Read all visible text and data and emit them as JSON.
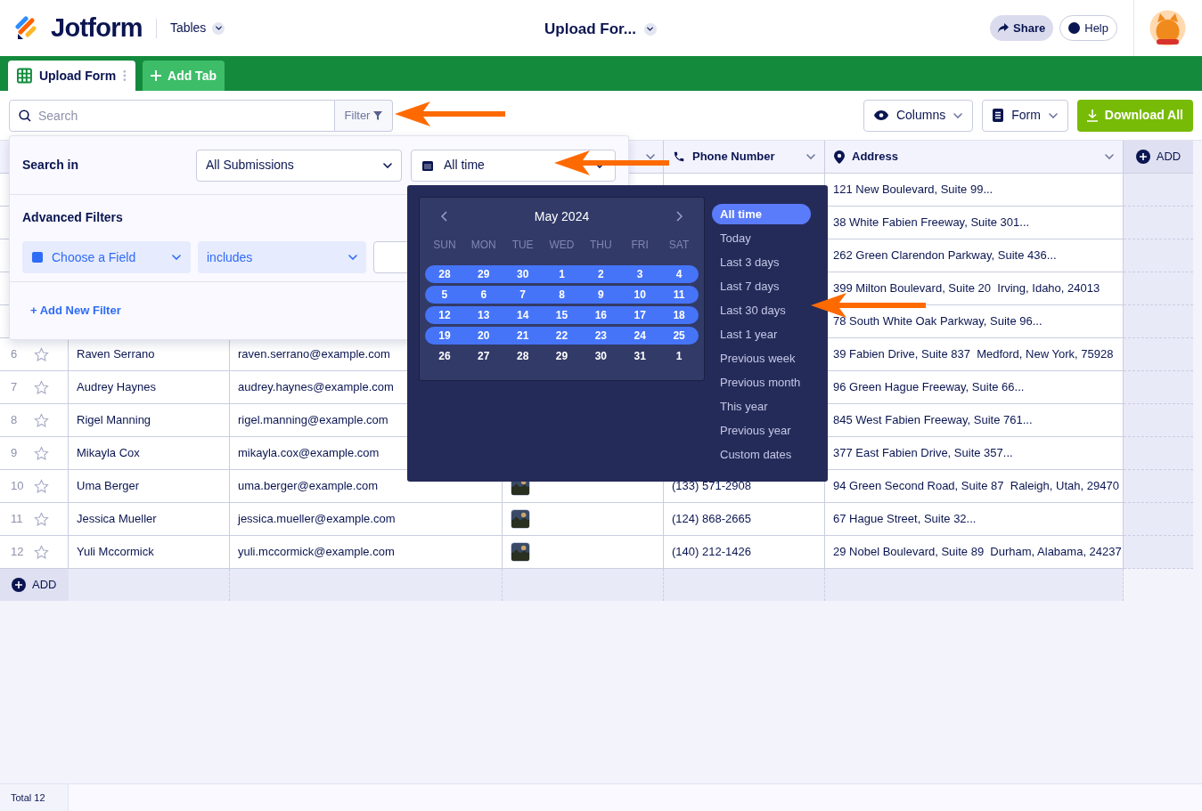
{
  "header": {
    "logo": "Jotform",
    "product": "Tables",
    "title": "Upload For...",
    "buttons": [
      "Share",
      "Help"
    ]
  },
  "tabs": [
    {
      "label": "Upload Form",
      "selected": true
    }
  ],
  "add_tab_button": "Add Tab",
  "toolbar": {
    "search": {
      "placeholder": "Search"
    },
    "filter": "Filter",
    "buttons": [
      "Columns",
      "Form",
      "Download All"
    ]
  },
  "table": {
    "columns": [
      {
        "label": "Phone Number",
        "kind": "phone"
      },
      {
        "label": "Address",
        "kind": "address"
      }
    ],
    "add_column": "ADD",
    "rows": [
      {
        "address": "121 New Boulevard, Suite 99..."
      },
      {
        "address": "38 White Fabien Freeway, Suite 301..."
      },
      {
        "address": "262 Green Clarendon Parkway, Suite 436..."
      },
      {
        "address": "399 Milton Boulevard, Suite 20  Irving, Idaho, 24013"
      },
      {
        "address": "78 South White Oak Parkway, Suite 96..."
      },
      {
        "number": "6",
        "starred": false,
        "name": "Raven Serrano",
        "email": "raven.serrano@example.com",
        "address": "39 Fabien Drive, Suite 837  Medford, New York, 75928"
      },
      {
        "number": "7",
        "starred": false,
        "name": "Audrey Haynes",
        "email": "audrey.haynes@example.com",
        "address": "96 Green Hague Freeway, Suite 66..."
      },
      {
        "number": "8",
        "starred": false,
        "name": "Rigel Manning",
        "email": "rigel.manning@example.com",
        "address": "845 West Fabien Freeway, Suite 761..."
      },
      {
        "number": "9",
        "starred": false,
        "name": "Mikayla Cox",
        "email": "mikayla.cox@example.com",
        "address": "377 East Fabien Drive, Suite 357..."
      },
      {
        "number": "10",
        "starred": false,
        "name": "Uma Berger",
        "email": "uma.berger@example.com",
        "phone": "(133) 571-2908",
        "address": "94 Green Second Road, Suite 87  Raleigh, Utah, 29470"
      },
      {
        "number": "11",
        "starred": false,
        "name": "Jessica Mueller",
        "email": "jessica.mueller@example.com",
        "phone": "(124) 868-2665",
        "address": "67 Hague Street, Suite 32..."
      },
      {
        "number": "12",
        "starred": false,
        "name": "Yuli Mccormick",
        "email": "yuli.mccormick@example.com",
        "phone": "(140) 212-1426",
        "address": "29 Nobel Boulevard, Suite 89  Durham, Alabama, 24237"
      }
    ],
    "add_row": "ADD"
  },
  "footer": {
    "total": "Total 12"
  },
  "filter_panel": {
    "search_in_label": "Search in",
    "scope": "All Submissions",
    "date_range": "All time",
    "advanced_label": "Advanced Filters",
    "field_select": "Choose a Field",
    "condition_select": "includes",
    "add_filter": "+ Add New Filter"
  },
  "date_popup": {
    "month": "May 2024",
    "weekdays": [
      "SUN",
      "MON",
      "TUE",
      "WED",
      "THU",
      "FRI",
      "SAT"
    ],
    "weeks": [
      {
        "selected": true,
        "days": [
          "28",
          "29",
          "30",
          "1",
          "2",
          "3",
          "4"
        ]
      },
      {
        "selected": true,
        "days": [
          "5",
          "6",
          "7",
          "8",
          "9",
          "10",
          "11"
        ]
      },
      {
        "selected": true,
        "days": [
          "12",
          "13",
          "14",
          "15",
          "16",
          "17",
          "18"
        ]
      },
      {
        "selected": true,
        "days": [
          "19",
          "20",
          "21",
          "22",
          "23",
          "24",
          "25"
        ]
      },
      {
        "selected": false,
        "days": [
          "26",
          "27",
          "28",
          "29",
          "30",
          "31",
          "1"
        ]
      }
    ],
    "presets": [
      {
        "label": "All time",
        "selected": true
      },
      {
        "label": "Today",
        "selected": false
      },
      {
        "label": "Last 3 days",
        "selected": false
      },
      {
        "label": "Last 7 days",
        "selected": false
      },
      {
        "label": "Last 30 days",
        "selected": false
      },
      {
        "label": "Last 1 year",
        "selected": false
      },
      {
        "label": "Previous week",
        "selected": false
      },
      {
        "label": "Previous month",
        "selected": false
      },
      {
        "label": "This year",
        "selected": false
      },
      {
        "label": "Previous year",
        "selected": false
      },
      {
        "label": "Custom dates",
        "selected": false
      }
    ]
  }
}
